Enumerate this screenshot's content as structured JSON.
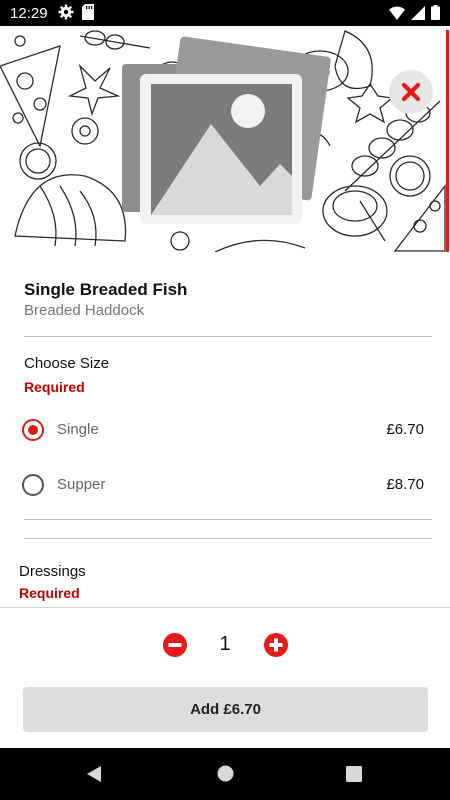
{
  "status_bar": {
    "time": "12:29",
    "icons": [
      "gear-icon",
      "sd-card-icon",
      "wifi-icon",
      "signal-icon",
      "battery-icon"
    ]
  },
  "hero": {
    "image": "image-placeholder-icon",
    "close_icon": "close-icon"
  },
  "product": {
    "name": "Single Breaded Fish",
    "description": "Breaded Haddock"
  },
  "size_section": {
    "title": "Choose Size",
    "required_label": "Required",
    "options": [
      {
        "label": "Single",
        "price": "£6.70",
        "selected": true
      },
      {
        "label": "Supper",
        "price": "£8.70",
        "selected": false
      }
    ]
  },
  "dressings_section": {
    "title": "Dressings",
    "required_label": "Required"
  },
  "quantity": {
    "value": "1",
    "decrement_icon": "minus-circle-icon",
    "increment_icon": "plus-circle-icon"
  },
  "add_button": {
    "label": "Add £6.70"
  },
  "nav_bar": {
    "icons": [
      "back-icon",
      "home-icon",
      "recents-icon"
    ]
  },
  "colors": {
    "accent": "#e41b17",
    "required": "#c00000",
    "button_bg": "#dddddd"
  }
}
